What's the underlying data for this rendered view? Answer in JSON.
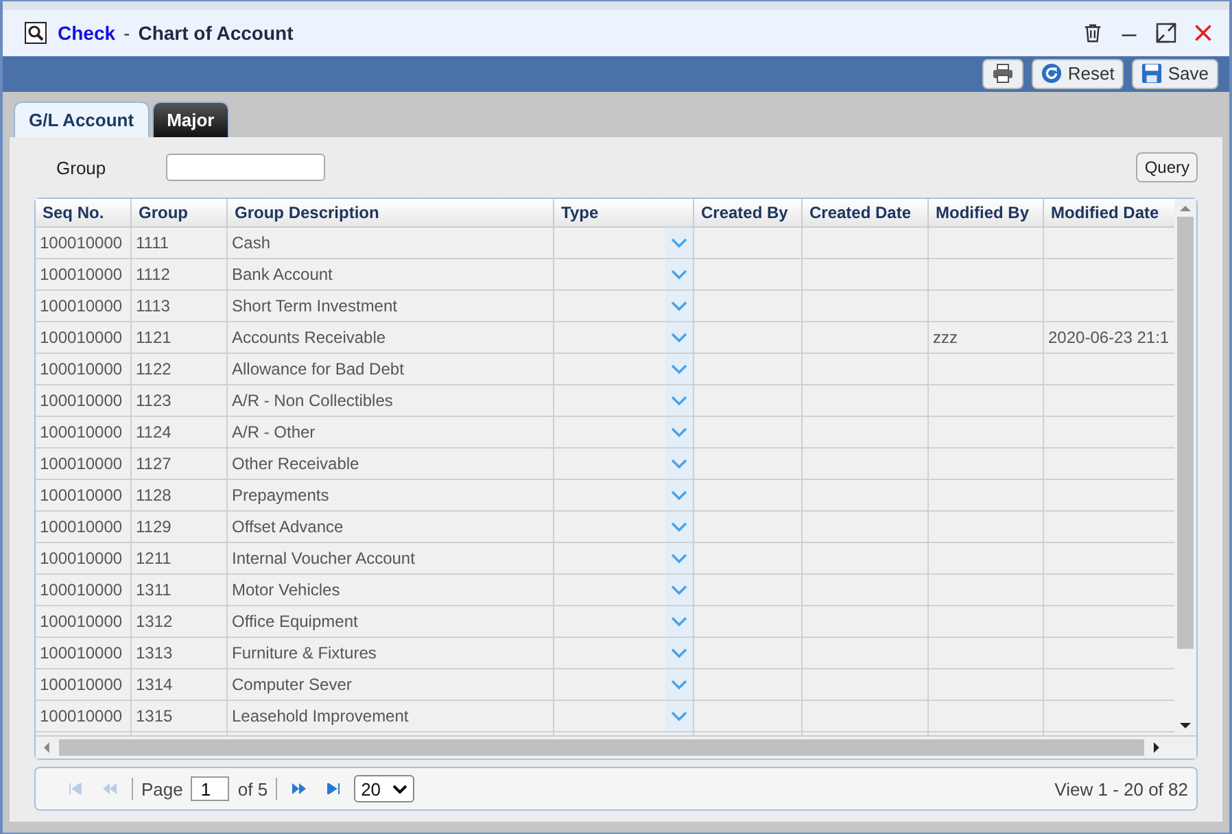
{
  "window": {
    "title_app": "Check",
    "title_separator": "-",
    "title": "Chart of Account"
  },
  "toolbar": {
    "buttons": [
      {
        "kind": "print"
      },
      {
        "kind": "reset",
        "label": "Reset"
      },
      {
        "kind": "save",
        "label": "Save"
      }
    ]
  },
  "tabs": [
    {
      "label": "G/L Account",
      "selected": true
    },
    {
      "label": "Major",
      "selected": false
    }
  ],
  "filter": {
    "label": "Group",
    "query_button": "Query"
  },
  "table": {
    "columns": [
      "Seq No.",
      "Group",
      "Group Description",
      "Type",
      "Created By",
      "Created Date",
      "Modified By",
      "Modified Date"
    ],
    "rows": [
      {
        "seq": "100010000",
        "group": "1111",
        "description": "Cash"
      },
      {
        "seq": "100010000",
        "group": "1112",
        "description": "Bank Account"
      },
      {
        "seq": "100010000",
        "group": "1113",
        "description": "Short Term Investment"
      },
      {
        "seq": "100010000",
        "group": "1121",
        "description": "Accounts Receivable",
        "modified_by": "zzz",
        "modified_date": "2020-06-23 21:1"
      },
      {
        "seq": "100010000",
        "group": "1122",
        "description": "Allowance for Bad Debt"
      },
      {
        "seq": "100010000",
        "group": "1123",
        "description": "A/R - Non Collectibles"
      },
      {
        "seq": "100010000",
        "group": "1124",
        "description": "A/R - Other"
      },
      {
        "seq": "100010000",
        "group": "1127",
        "description": "Other Receivable"
      },
      {
        "seq": "100010000",
        "group": "1128",
        "description": "Prepayments"
      },
      {
        "seq": "100010000",
        "group": "1129",
        "description": "Offset Advance"
      },
      {
        "seq": "100010000",
        "group": "1211",
        "description": "Internal Voucher Account"
      },
      {
        "seq": "100010000",
        "group": "1311",
        "description": "Motor Vehicles"
      },
      {
        "seq": "100010000",
        "group": "1312",
        "description": "Office Equipment"
      },
      {
        "seq": "100010000",
        "group": "1313",
        "description": "Furniture & Fixtures"
      },
      {
        "seq": "100010000",
        "group": "1314",
        "description": "Computer Sever"
      },
      {
        "seq": "100010000",
        "group": "1315",
        "description": "Leasehold Improvement"
      }
    ]
  },
  "pager": {
    "first_disabled": true,
    "prev_disabled": true,
    "next_disabled": false,
    "last_disabled": false,
    "page_label": "Page",
    "page": "1",
    "of_label": "of",
    "pages": "5",
    "page_size": "20",
    "view": "View",
    "range": "1 - 20",
    "of_total_label": "of",
    "total": "82"
  }
}
